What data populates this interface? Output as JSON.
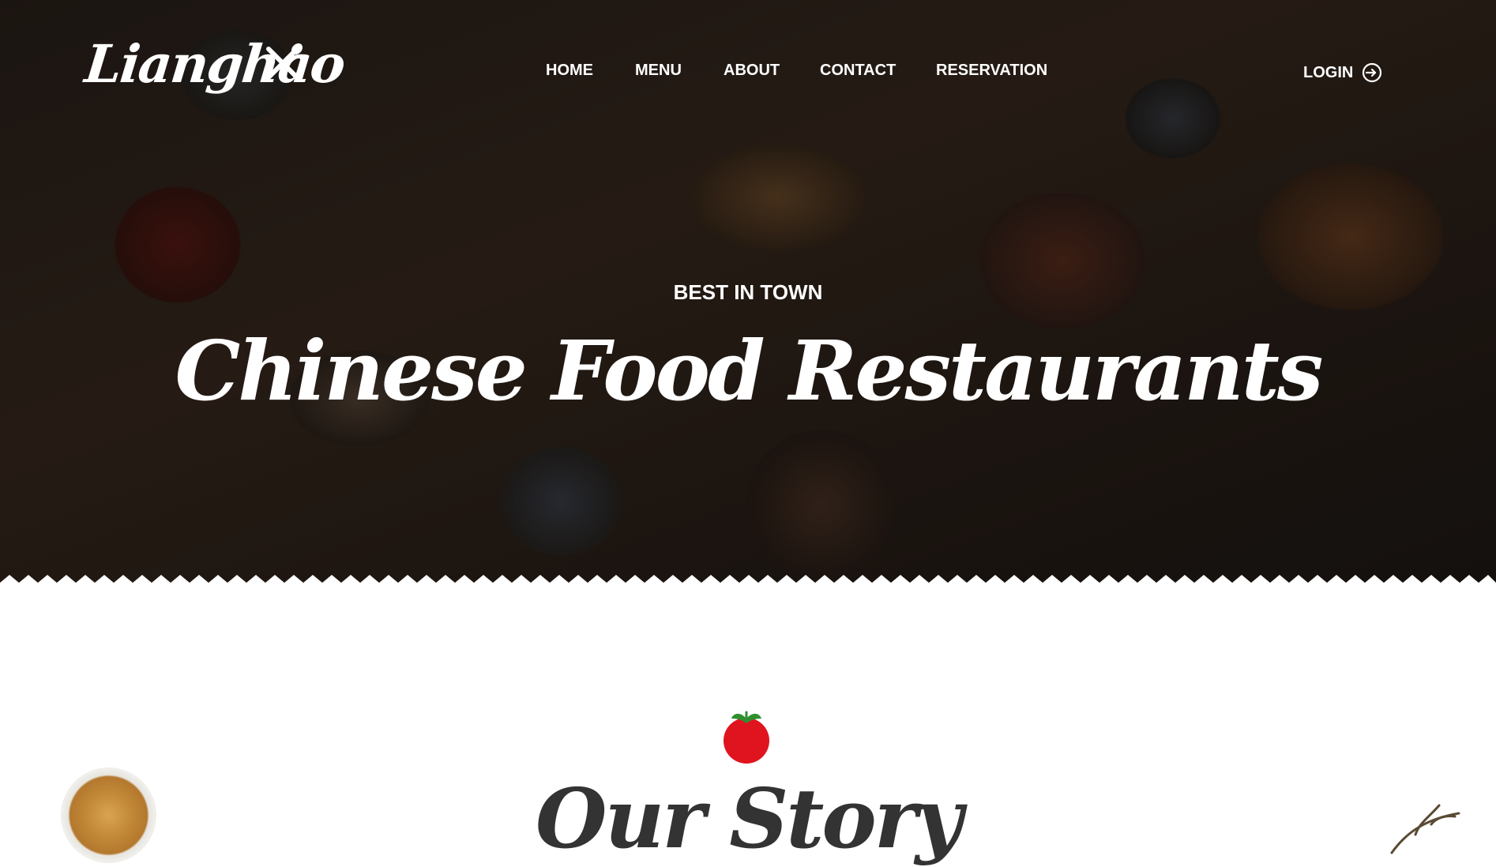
{
  "brand": {
    "name": "Lianghao",
    "icon": "fork-knife-icon"
  },
  "nav": {
    "items": [
      {
        "label": "HOME"
      },
      {
        "label": "MENU"
      },
      {
        "label": "ABOUT"
      },
      {
        "label": "CONTACT"
      },
      {
        "label": "RESERVATION"
      }
    ],
    "login": {
      "label": "LOGIN",
      "icon": "login-arrow-icon"
    }
  },
  "hero": {
    "eyebrow": "BEST IN TOWN",
    "headline": "Chinese Food Restaurants"
  },
  "story": {
    "icon": "tomato-icon",
    "title": "Our Story"
  },
  "colors": {
    "text_light": "#ffffff",
    "text_dark": "#333333",
    "tomato": "#e0141e",
    "leaf": "#2f8f2f"
  }
}
